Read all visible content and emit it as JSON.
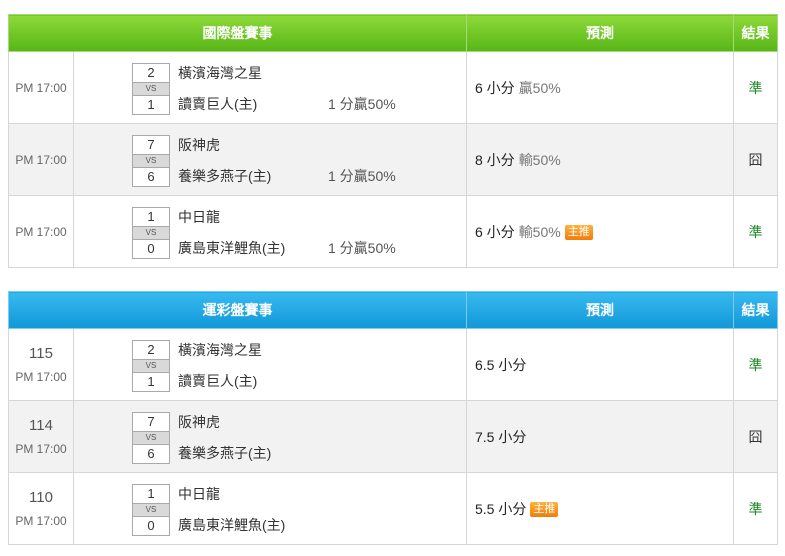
{
  "table1": {
    "headers": {
      "event": "國際盤賽事",
      "prediction": "預測",
      "result": "結果"
    },
    "rows": [
      {
        "time": "PM 17:00",
        "score_a": "2",
        "vs": "VS",
        "score_b": "1",
        "team_a": "橫濱海灣之星",
        "team_b": "讀賣巨人(主)",
        "odds": "1 分贏50%",
        "pred": "6 小分",
        "pct": "贏50%",
        "badge": "",
        "result": "準",
        "result_type": "good"
      },
      {
        "time": "PM 17:00",
        "score_a": "7",
        "vs": "VS",
        "score_b": "6",
        "team_a": "阪神虎",
        "team_b": "養樂多燕子(主)",
        "odds": "1 分贏50%",
        "pred": "8 小分",
        "pct": "輸50%",
        "badge": "",
        "result": "囧",
        "result_type": "bad"
      },
      {
        "time": "PM 17:00",
        "score_a": "1",
        "vs": "VS",
        "score_b": "0",
        "team_a": "中日龍",
        "team_b": "廣島東洋鯉魚(主)",
        "odds": "1 分贏50%",
        "pred": "6 小分",
        "pct": "輸50%",
        "badge": "主推",
        "result": "準",
        "result_type": "good"
      }
    ]
  },
  "table2": {
    "headers": {
      "event": "運彩盤賽事",
      "prediction": "預測",
      "result": "結果"
    },
    "rows": [
      {
        "no": "115",
        "time": "PM 17:00",
        "score_a": "2",
        "vs": "VS",
        "score_b": "1",
        "team_a": "橫濱海灣之星",
        "team_b": "讀賣巨人(主)",
        "pred": "6.5 小分",
        "badge": "",
        "result": "準",
        "result_type": "good"
      },
      {
        "no": "114",
        "time": "PM 17:00",
        "score_a": "7",
        "vs": "VS",
        "score_b": "6",
        "team_a": "阪神虎",
        "team_b": "養樂多燕子(主)",
        "pred": "7.5 小分",
        "badge": "",
        "result": "囧",
        "result_type": "bad"
      },
      {
        "no": "110",
        "time": "PM 17:00",
        "score_a": "1",
        "vs": "VS",
        "score_b": "0",
        "team_a": "中日龍",
        "team_b": "廣島東洋鯉魚(主)",
        "pred": "5.5 小分",
        "badge": "主推",
        "result": "準",
        "result_type": "good"
      }
    ]
  },
  "colors": {
    "good": "#1e8a25",
    "bad": "#333333",
    "header1": "#6cc224",
    "header2": "#1ea6e4",
    "badge": "#f28c1c"
  }
}
